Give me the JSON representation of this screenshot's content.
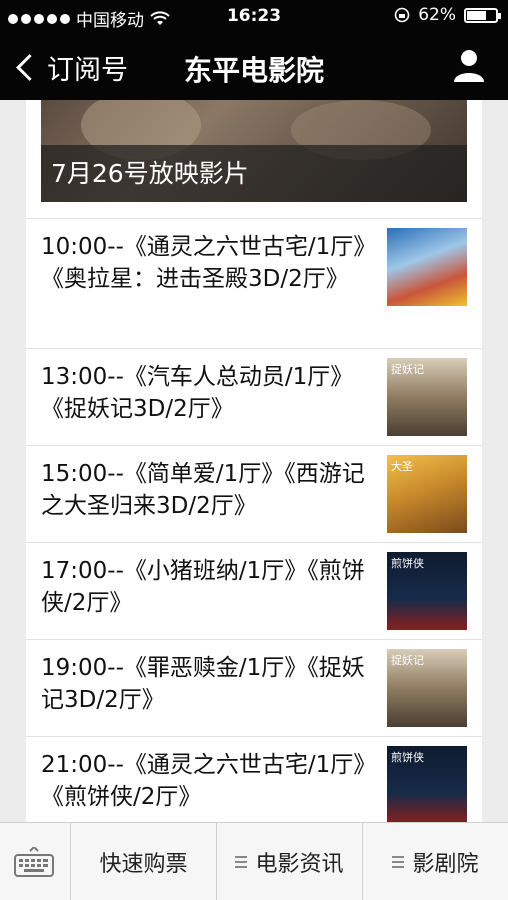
{
  "status_bar": {
    "carrier": "中国移动",
    "time": "16:23",
    "battery": "62%",
    "battery_level": 0.62
  },
  "nav": {
    "back_label": "订阅号",
    "title": "东平电影院",
    "user_icon": "user-icon"
  },
  "banner": {
    "caption": "7月26号放映影片"
  },
  "schedule": [
    {
      "text": "10:00--《通灵之六世古宅/1厅》《奥拉星：进击圣殿3D/2厅》",
      "thumb_caption": ""
    },
    {
      "text": "13:00--《汽车人总动员/1厅》《捉妖记3D/2厅》",
      "thumb_caption": "捉妖记"
    },
    {
      "text": "15:00--《简单爱/1厅》《西游记之大圣归来3D/2厅》",
      "thumb_caption": "大圣"
    },
    {
      "text": "17:00--《小猪班纳/1厅》《煎饼侠/2厅》",
      "thumb_caption": "煎饼侠"
    },
    {
      "text": "19:00--《罪恶赎金/1厅》《捉妖记3D/2厅》",
      "thumb_caption": "捉妖记"
    },
    {
      "text": "21:00--《通灵之六世古宅/1厅》《煎饼侠/2厅》",
      "thumb_caption": "煎饼侠"
    }
  ],
  "tabbar": {
    "keyboard_icon": "keyboard-icon",
    "tabs": [
      {
        "label": "快速购票"
      },
      {
        "label": "电影资讯"
      },
      {
        "label": "影剧院"
      }
    ]
  }
}
